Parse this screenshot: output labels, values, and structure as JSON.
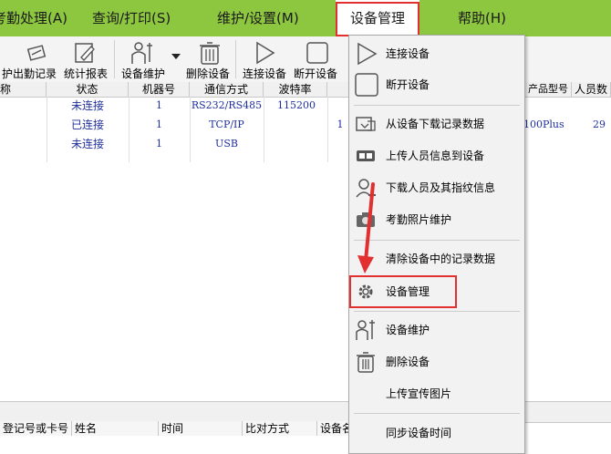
{
  "menubar": {
    "items": [
      "考勤处理(A)",
      "查询/打印(S)",
      "维护/设置(M)",
      "设备管理",
      "帮助(H)"
    ]
  },
  "toolbar": {
    "labels": [
      "护",
      "出勤记录",
      "统计报表",
      "设备维护",
      "删除设备",
      "连接设备",
      "断开设备"
    ]
  },
  "grid": {
    "headers": [
      "称",
      "状态",
      "机器号",
      "通信方式",
      "波特率",
      "产品型号",
      "人员数"
    ],
    "rows": [
      {
        "status": "未连接",
        "machine": "1",
        "comm": "RS232/RS485",
        "baud": "115200",
        "model": "",
        "users": ""
      },
      {
        "status": "已连接",
        "machine": "1",
        "comm": "TCP/IP",
        "baud": "",
        "model": "100Plus",
        "users": "29"
      },
      {
        "status": "未连接",
        "machine": "1",
        "comm": "USB",
        "baud": "",
        "model": "",
        "users": ""
      }
    ],
    "row_marker": "1"
  },
  "bottom_table": {
    "headers": [
      "登记号或卡号",
      "姓名",
      "时间",
      "比对方式",
      "设备名"
    ]
  },
  "dropdown": {
    "items": [
      {
        "label": "连接设备",
        "icon": "play-outline-icon"
      },
      {
        "label": "断开设备",
        "icon": "square-outline-icon"
      },
      {
        "label": "从设备下载记录数据",
        "icon": "download-records-icon"
      },
      {
        "label": "上传人员信息到设备",
        "icon": "upload-users-icon"
      },
      {
        "label": "下载人员及其指纹信息",
        "icon": "download-fingerprint-icon"
      },
      {
        "label": "考勤照片维护",
        "icon": "camera-icon"
      },
      {
        "label": "清除设备中的记录数据",
        "icon": ""
      },
      {
        "label": "设备管理",
        "icon": "gear-icon"
      },
      {
        "label": "设备维护",
        "icon": "worker-icon"
      },
      {
        "label": "删除设备",
        "icon": "trash-icon"
      },
      {
        "label": "上传宣传图片",
        "icon": ""
      },
      {
        "label": "同步设备时间",
        "icon": ""
      }
    ]
  },
  "colors": {
    "menubar": "#8dc63f",
    "highlight": "#e23030",
    "blue_text": "#1f2f9f"
  }
}
